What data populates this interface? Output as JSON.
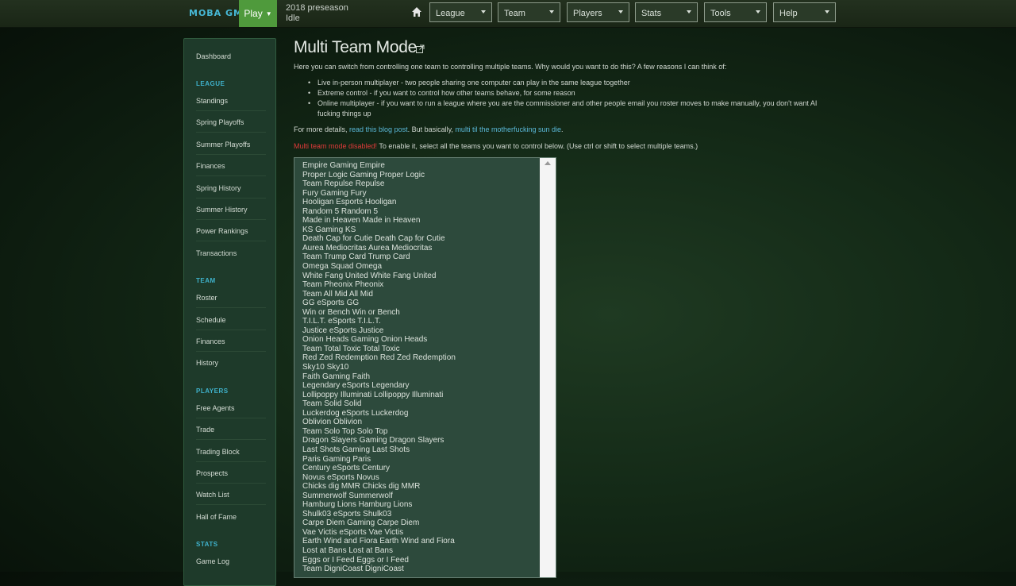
{
  "topbar": {
    "logo": "MOBA GM",
    "play_label": "Play",
    "season": "2018 preseason",
    "status": "Idle",
    "menus": [
      "League",
      "Team",
      "Players",
      "Stats",
      "Tools",
      "Help"
    ]
  },
  "sidebar": {
    "dashboard": "Dashboard",
    "sections": [
      {
        "header": "LEAGUE",
        "items": [
          "Standings",
          "Spring Playoffs",
          "Summer Playoffs",
          "Finances",
          "Spring History",
          "Summer History",
          "Power Rankings",
          "Transactions"
        ]
      },
      {
        "header": "TEAM",
        "items": [
          "Roster",
          "Schedule",
          "Finances",
          "History"
        ]
      },
      {
        "header": "PLAYERS",
        "items": [
          "Free Agents",
          "Trade",
          "Trading Block",
          "Prospects",
          "Watch List",
          "Hall of Fame"
        ]
      },
      {
        "header": "STATS",
        "items": [
          "Game Log"
        ]
      }
    ]
  },
  "main": {
    "title": "Multi Team Mode",
    "intro": "Here you can switch from controlling one team to controlling multiple teams. Why would you want to do this? A few reasons I can think of:",
    "bullets": [
      "Live in-person multiplayer - two people sharing one computer can play in the same league together",
      "Extreme control - if you want to control how other teams behave, for some reason",
      "Online multiplayer - if you want to run a league where you are the commissioner and other people email you roster moves to make manually, you don't want AI fucking things up"
    ],
    "more_prefix": "For more details, ",
    "more_link1": "read this blog post",
    "more_mid": ". But basically, ",
    "more_link2": "multi til the motherfucking sun die",
    "more_suffix": ".",
    "disabled_label": "Multi team mode disabled!",
    "disabled_text": " To enable it, select all the teams you want to control below. (Use ctrl or shift to select multiple teams.)",
    "teams": [
      "Empire Gaming Empire",
      "Proper Logic Gaming Proper Logic",
      "Team Repulse Repulse",
      "Fury Gaming Fury",
      "Hooligan Esports Hooligan",
      "Random 5 Random 5",
      "Made in Heaven Made in Heaven",
      "KS Gaming KS",
      "Death Cap for Cutie Death Cap for Cutie",
      "Aurea Mediocritas Aurea Mediocritas",
      "Team Trump Card Trump Card",
      "Omega Squad Omega",
      "White Fang United White Fang United",
      "Team Pheonix Pheonix",
      "Team All Mid All Mid",
      "GG eSports GG",
      "Win or Bench Win or Bench",
      "T.I.L.T. eSports T.I.L.T.",
      "Justice eSports Justice",
      "Onion Heads Gaming Onion Heads",
      "Team Total Toxic Total Toxic",
      "Red Zed Redemption Red Zed Redemption",
      "Sky10 Sky10",
      "Faith Gaming Faith",
      "Legendary eSports Legendary",
      "Lollipoppy Illuminati Lollipoppy Illuminati",
      "Team Solid Solid",
      "Luckerdog eSports Luckerdog",
      "Oblivion Oblivion",
      "Team Solo Top Solo Top",
      "Dragon Slayers Gaming Dragon Slayers",
      "Last Shots Gaming Last Shots",
      "Paris Gaming Paris",
      "Century eSports Century",
      "Novus eSports Novus",
      "Chicks dig MMR Chicks dig MMR",
      "Summerwolf Summerwolf",
      "Hamburg Lions Hamburg Lions",
      "Shulk03 eSports Shulk03",
      "Carpe Diem Gaming Carpe Diem",
      "Vae Victis eSports Vae Victis",
      "Earth Wind and Fiora Earth Wind and Fiora",
      "Lost at Bans Lost at Bans",
      "Eggs or I Feed Eggs or I Feed",
      "Team DigniCoast DigniCoast"
    ]
  },
  "colors": {
    "accent": "#4f9a3c",
    "link": "#5ab8d8",
    "alert": "#e03a3a",
    "section": "#3fb2cc"
  }
}
